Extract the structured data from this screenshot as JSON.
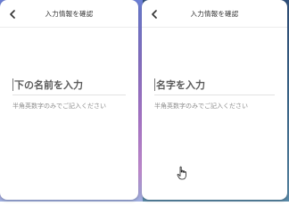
{
  "left_panel": {
    "title": "入力情報を確認",
    "input_text": "下の名前を入力",
    "helper_text": "半角英数字のみでご記入ください"
  },
  "right_panel": {
    "title": "入力情報を確認",
    "input_text": "名字を入力",
    "helper_text": "半角英数字のみでご記入ください"
  },
  "icons": {
    "back": "chevron-left-icon",
    "cursor": "hand-pointer-icon"
  },
  "colors": {
    "left_background": "#8a73c8",
    "right_background": "#3d6a8f",
    "title_text": "#333333",
    "input_text": "#5a5a5a",
    "helper_text": "#8d8d8d"
  }
}
